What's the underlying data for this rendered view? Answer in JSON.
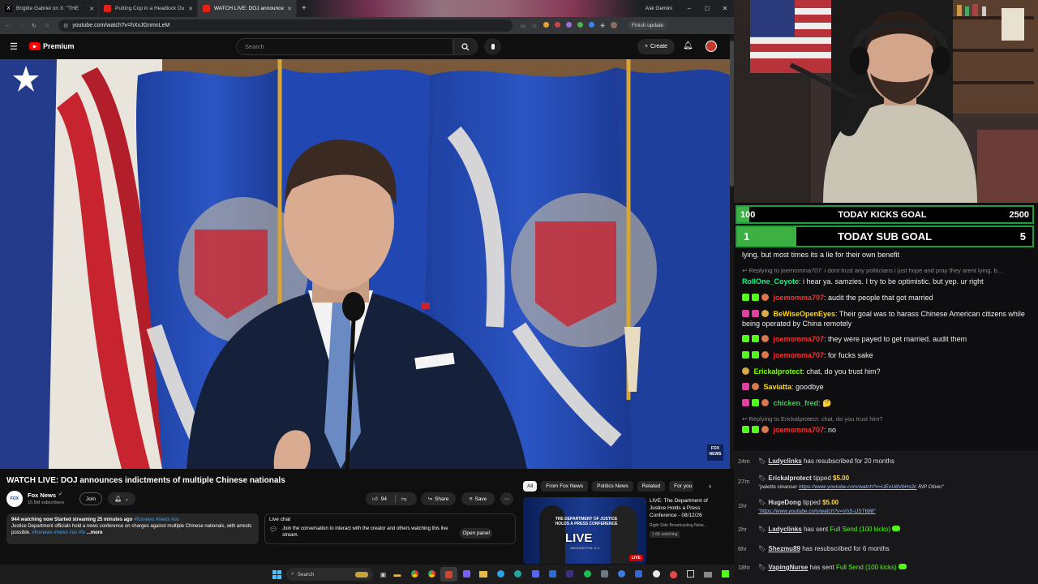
{
  "browser": {
    "tabs": [
      {
        "title": "Brigitte Gabriel on X: \"THE",
        "fav": "#111"
      },
      {
        "title": "Putting Cop in a Headlock Du",
        "fav": "#e62117"
      },
      {
        "title": "WATCH LIVE: DOJ announce",
        "fav": "#e62117"
      }
    ],
    "ask_gemini": "Ask Gemini",
    "url": "youtube.com/watch?v=hXvJGnmnLeM",
    "finish_update": "Finish update"
  },
  "youtube": {
    "brand": "Premium",
    "search_placeholder": "Search",
    "create_label": "Create",
    "video_title": "WATCH LIVE: DOJ announces indictments of multiple Chinese nationals",
    "channel_name": "Fox News",
    "subscribers": "15.5M subscribers",
    "join_label": "Join",
    "likes": "94",
    "share_label": "Share",
    "save_label": "Save",
    "desc_stats": "944 watching now  Started streaming 25 minutes ago",
    "desc_tags": "#foxnews #news #us",
    "desc_text": "Justice Department officials hold a news conference on charges against multiple Chinese nationals, with arrests possible.",
    "desc_tags2": "#foxnews #news #us #fo",
    "desc_more": "...more",
    "live_chat_title": "Live chat",
    "live_chat_text": "Join the conversation to interact with the creator and others watching this live stream.",
    "open_panel": "Open panel",
    "chips": [
      "All",
      "From Fox News",
      "Politics News",
      "Related",
      "For you"
    ],
    "rec_title": "LIVE: The Department of Justice Holds a Press Conference - 08/12/26",
    "rec_channel": "Right Side Broadcasting Netw...",
    "rec_views": "1.6K watching",
    "rec_thumb_text": "THE DEPARTMENT OF JUSTICE HOLDS A PRESS CONFERENCE",
    "rec_thumb_live": "LIVE",
    "rec_thumb_loc": "WASHINGTON, D.C.",
    "fox_bug": "FOX NEWS"
  },
  "taskbar": {
    "search": "Search"
  },
  "stream": {
    "kicks_goal": {
      "left": "100",
      "label": "TODAY KICKS GOAL",
      "right": "2500",
      "progress": 0.04
    },
    "sub_goal": {
      "left": "1",
      "label": "TODAY SUB GOAL",
      "right": "5",
      "progress": 0.2
    }
  },
  "chat": {
    "line0": "lying. but most times its a lie for their own benefit",
    "reply1": "Replying to joemomma707: i dont trust any politicians i just hope and pray they arent lying. b...",
    "messages": [
      {
        "user": "RollOne_Coyote",
        "color": "#00ff7f",
        "text": ": i hear ya. samzies. I try to be optimistic. but yep. ur right"
      },
      {
        "user": "joemomma707",
        "color": "#ff2d2d",
        "text": ": audit the people that got married"
      },
      {
        "user": "BeWiseOpenEyes",
        "color": "#ffd700",
        "text": ": Their goal was to harass Chinese American citizens while being operated by China remotely"
      },
      {
        "user": "joemomma707",
        "color": "#ff2d2d",
        "text": ": they were payed to get married. audit them"
      },
      {
        "user": "joemomma707",
        "color": "#ff2d2d",
        "text": ": for fucks sake"
      },
      {
        "user": "Erickalprotect",
        "color": "#7cfc00",
        "text": ": chat, do you trust him?"
      },
      {
        "user": "Saviatta",
        "color": "#ffd700",
        "text": ": goodbye"
      },
      {
        "user": "chicken_fred",
        "color": "#39d353",
        "text": ": 🤔"
      }
    ],
    "reply2": "Replying to Erickalprotect: chat, do you trust him?",
    "last_user": "joemomma707",
    "last_text": ": no"
  },
  "events": [
    {
      "time": "24m",
      "user": "Ladyclinks",
      "text": " has resubscribed for 20 months"
    },
    {
      "time": "27m",
      "user": "Erickalprotect",
      "text": " tipped ",
      "amount": "$5.00",
      "note_link": "https://www.youtube.com/watch?v=UEoU6VbHs2c",
      "note_tail": " RIP Oliver\""
    },
    {
      "time": "1hr",
      "user": "HugeDong",
      "text": " tipped ",
      "amount": "$5.00",
      "note_link": "\"https://www.youtube.com/watch?v=VnS-iJST688\""
    },
    {
      "time": "2hr",
      "user": "Ladyclinks",
      "text": " has sent ",
      "highlight": "Full Send (100 kicks)"
    },
    {
      "time": "6hr",
      "user": "Shezmu89",
      "text": " has resubscribed for 6 months"
    },
    {
      "time": "18hr",
      "user": "VapingNurse",
      "text": " has sent ",
      "highlight": "Full Send (100 kicks)"
    }
  ],
  "event_note_prefix": "\"palette cleanser ",
  "colors": {
    "goal_green": "#3cb043",
    "accent_red": "#ff0000",
    "event_green": "#53fc18"
  }
}
